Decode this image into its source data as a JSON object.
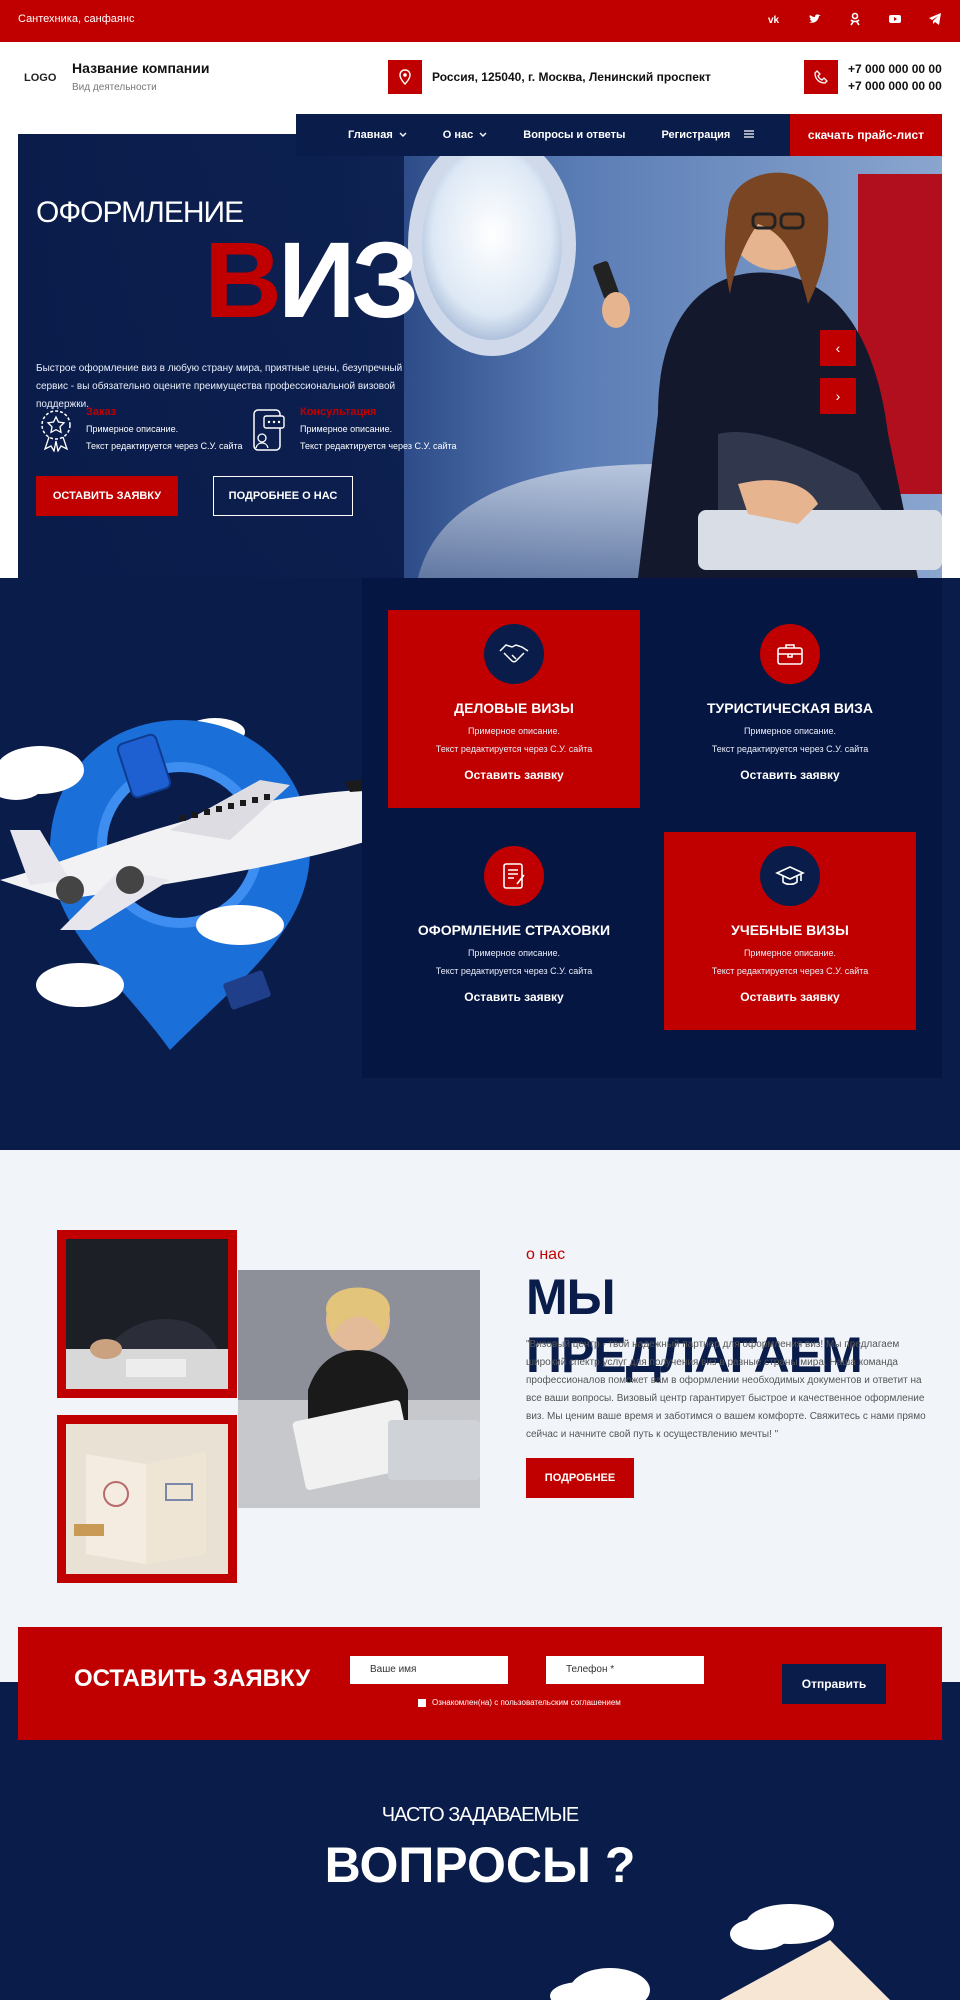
{
  "topbar": {
    "tagline": "Сантехника, санфаянс",
    "social": [
      "vk-icon",
      "twitter-icon",
      "odnoklassniki-icon",
      "youtube-icon",
      "telegram-icon"
    ]
  },
  "header": {
    "logo": "LOGO",
    "company_name": "Название компании",
    "company_activity": "Вид деятельности",
    "address": "Россия, 125040, г. Москва, Ленинский проспект",
    "phones": [
      "+7 000 000 00 00",
      "+7 000 000 00 00"
    ]
  },
  "nav": {
    "items": [
      "Главная",
      "О нас",
      "Вопросы и ответы",
      "Регистрация"
    ],
    "price_button": "скачать прайс-лист"
  },
  "hero": {
    "subtitle": "ОФОРМЛЕНИЕ",
    "title_first": "В",
    "title_rest": "ИЗ",
    "description": "Быстрое оформление виз в любую страну мира, приятные цены, безупречный сервис - вы обязательно оцените преимущества профессиональной визовой поддержки.",
    "features": [
      {
        "title": "Заказ",
        "line1": "Примерное описание.",
        "line2": "Текст редактируется через С.У. сайта"
      },
      {
        "title": "Консультация",
        "line1": "Примерное описание.",
        "line2": "Текст редактируется через С.У. сайта"
      }
    ],
    "btn_primary": "ОСТАВИТЬ ЗАЯВКУ",
    "btn_secondary": "ПОДРОБНЕЕ О НАС",
    "arrow_prev": "‹",
    "arrow_next": "›"
  },
  "services": [
    {
      "title": "ДЕЛОВЫЕ ВИЗЫ",
      "line1": "Примерное описание.",
      "line2": "Текст редактируется через С.У. сайта",
      "cta": "Оставить заявку",
      "icon": "handshake-icon"
    },
    {
      "title": "ТУРИСТИЧЕСКАЯ ВИЗА",
      "line1": "Примерное описание.",
      "line2": "Текст редактируется через С.У. сайта",
      "cta": "Оставить заявку",
      "icon": "briefcase-icon"
    },
    {
      "title": "ОФОРМЛЕНИЕ СТРАХОВКИ",
      "line1": "Примерное описание.",
      "line2": "Текст редактируется через С.У. сайта",
      "cta": "Оставить заявку",
      "icon": "document-icon"
    },
    {
      "title": "УЧЕБНЫЕ ВИЗЫ",
      "line1": "Примерное описание.",
      "line2": "Текст редактируется через С.У. сайта",
      "cta": "Оставить заявку",
      "icon": "graduation-cap-icon"
    }
  ],
  "about": {
    "kicker": "о нас",
    "title": "МЫ ПРЕДЛАГАЕМ",
    "text": "\"Визовый центр - твой надежный партнер для оформления виз! Мы предлагаем широкий спектр услуг для получения виз в разные страны мира. Наша команда профессионалов поможет вам в оформлении необходимых документов и ответит на все ваши вопросы. Визовый центр гарантирует быстрое и качественное оформление виз. Мы ценим ваше время и заботимся о вашем комфорте. Свяжитесь с нами прямо сейчас и начните свой путь к осуществлению мечты! \"",
    "button": "ПОДРОБНЕЕ"
  },
  "form": {
    "title": "ОСТАВИТЬ ЗАЯВКУ",
    "name_placeholder": "Ваше имя",
    "phone_placeholder": "Телефон *",
    "consent": "Ознакомлен(на) с пользовательским соглашением",
    "submit": "Отправить"
  },
  "faq": {
    "kicker": "ЧАСТО ЗАДАВАЕМЫЕ",
    "title": "ВОПРОСЫ ?"
  },
  "colors": {
    "red": "#c00000",
    "navy": "#0a1c4a",
    "light": "#f1f5fa"
  }
}
